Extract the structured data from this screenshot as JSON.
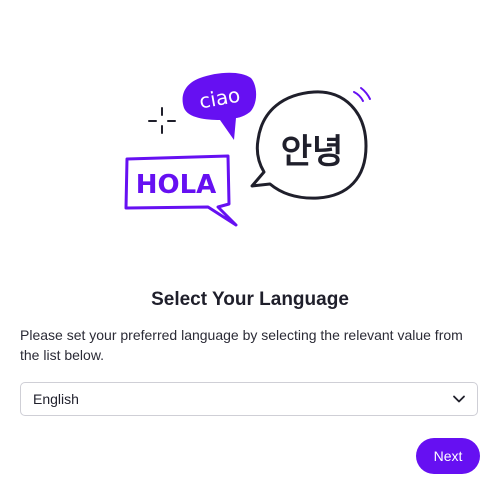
{
  "illustration": {
    "bubble_ciao": "ciao",
    "bubble_hola": "HOLA",
    "bubble_korean": "안녕",
    "accent_color": "#6610f2",
    "outline_color": "#1f1f2b"
  },
  "dialog": {
    "title": "Select Your Language",
    "description": "Please set your preferred language by selecting the relevant value from the list below."
  },
  "language_select": {
    "selected": "English",
    "icon": "chevron-down-icon"
  },
  "actions": {
    "next_label": "Next",
    "next_color": "#6610f2"
  }
}
